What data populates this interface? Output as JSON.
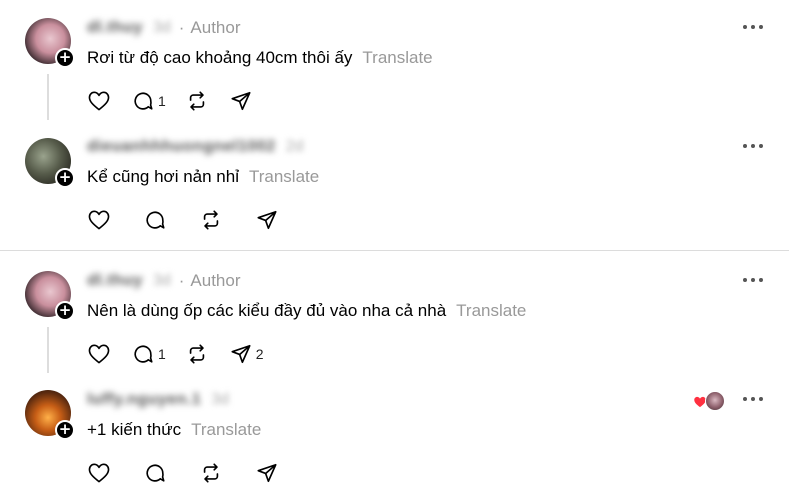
{
  "thread1": {
    "reply1": {
      "username": "dl.thuy",
      "time": "3d",
      "author_label": "Author",
      "text": "Rơi từ độ cao khoảng 40cm thôi ấy",
      "translate": "Translate",
      "reply_count": "1",
      "share_count": ""
    },
    "reply2": {
      "username": "dieuanhhhuongnel1002",
      "time": "2d",
      "text": "Kể cũng hơi nản nhỉ",
      "translate": "Translate"
    }
  },
  "thread2": {
    "reply1": {
      "username": "dl.thuy",
      "time": "3d",
      "author_label": "Author",
      "text": "Nên là dùng ốp các kiểu đầy đủ vào nha cả nhà",
      "translate": "Translate",
      "reply_count": "1",
      "share_count": "2"
    },
    "reply2": {
      "username": "luffy.nguyen.1",
      "time": "3d",
      "text": "+1 kiến thức",
      "translate": "Translate"
    }
  },
  "icons": {
    "like": "heart-icon",
    "reply": "comment-icon",
    "repost": "repost-icon",
    "share": "send-icon",
    "more": "more-icon",
    "badge": "plus-icon"
  },
  "colors": {
    "muted": "#999999",
    "liked_heart": "#ff3040"
  }
}
